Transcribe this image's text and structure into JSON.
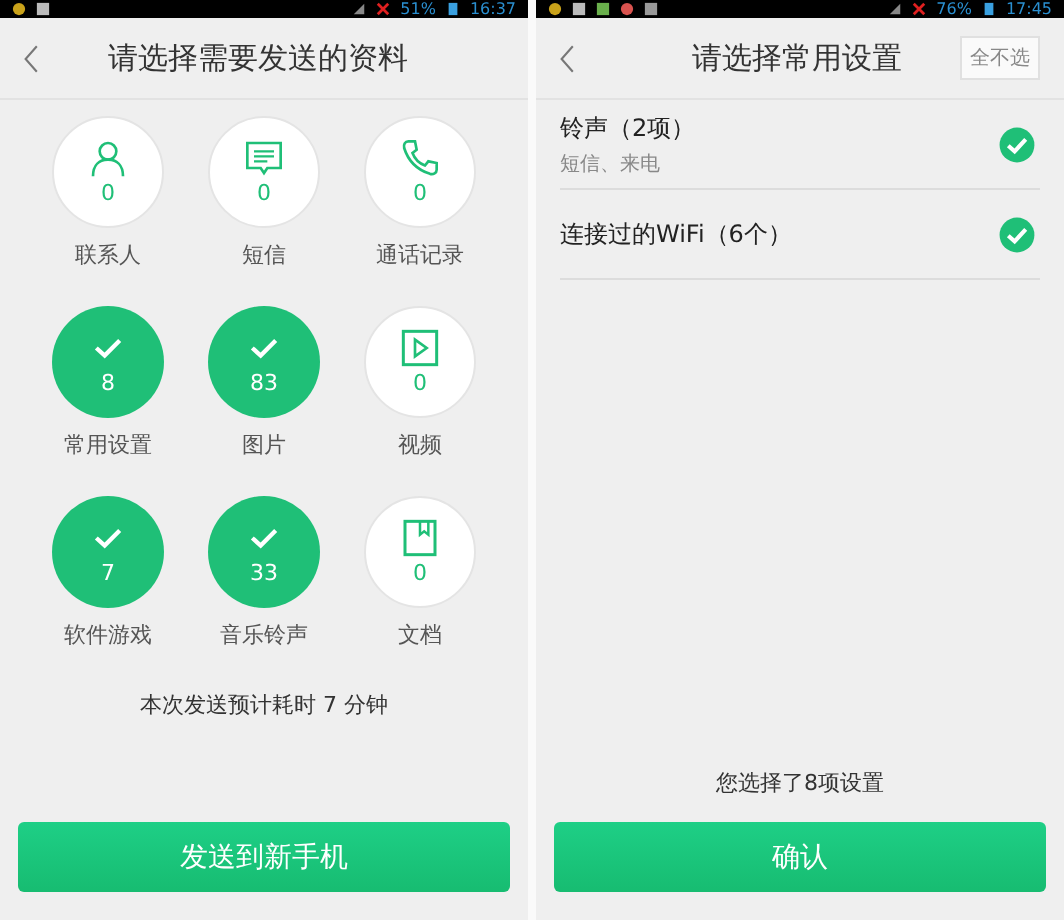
{
  "left_screen": {
    "status_bar": {
      "battery": "51%",
      "time": "16:37"
    },
    "title": "请选择需要发送的资料",
    "items": [
      {
        "label": "联系人",
        "count": "0",
        "selected": false
      },
      {
        "label": "短信",
        "count": "0",
        "selected": false
      },
      {
        "label": "通话记录",
        "count": "0",
        "selected": false
      },
      {
        "label": "常用设置",
        "count": "8",
        "selected": true
      },
      {
        "label": "图片",
        "count": "83",
        "selected": true
      },
      {
        "label": "视频",
        "count": "0",
        "selected": false
      },
      {
        "label": "软件游戏",
        "count": "7",
        "selected": true
      },
      {
        "label": "音乐铃声",
        "count": "33",
        "selected": true
      },
      {
        "label": "文档",
        "count": "0",
        "selected": false
      }
    ],
    "estimate": "本次发送预计耗时 7 分钟",
    "button": "发送到新手机"
  },
  "right_screen": {
    "status_bar": {
      "battery": "76%",
      "time": "17:45"
    },
    "title": "请选择常用设置",
    "deselect_all": "全不选",
    "settings": [
      {
        "title": "铃声（2项）",
        "subtitle": "短信、来电",
        "checked": true
      },
      {
        "title": "连接过的WiFi（6个）",
        "checked": true
      }
    ],
    "summary": "您选择了8项设置",
    "button": "确认"
  }
}
